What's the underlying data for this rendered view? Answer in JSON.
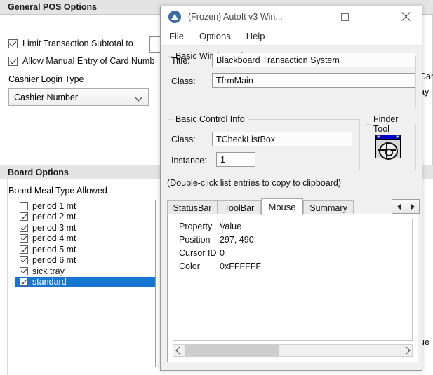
{
  "background": {
    "general_pos": {
      "header": "General POS Options",
      "checkboxes": [
        {
          "label": "Limit Transaction Subtotal to",
          "checked": true
        },
        {
          "label": "Allow Manual Entry of Card Numb",
          "checked": true
        }
      ],
      "subtotal_value": "",
      "cashier_login_label": "Cashier Login Type",
      "cashier_login_value": "Cashier Number"
    },
    "board_options": {
      "header": "Board Options",
      "list_label": "Board Meal Type Allowed",
      "items": [
        {
          "label": "period 1 mt",
          "checked": false,
          "selected": false
        },
        {
          "label": "period 2 mt",
          "checked": true,
          "selected": false
        },
        {
          "label": "period 3 mt",
          "checked": true,
          "selected": false
        },
        {
          "label": "period 4 mt",
          "checked": true,
          "selected": false
        },
        {
          "label": "period 5 mt",
          "checked": true,
          "selected": false
        },
        {
          "label": "period 6 mt",
          "checked": true,
          "selected": false
        },
        {
          "label": "sick tray",
          "checked": true,
          "selected": false
        },
        {
          "label": "standard",
          "checked": true,
          "selected": true
        }
      ]
    },
    "edge_fragments": {
      "card": "Car",
      "ay": "ay",
      "ue": "ue"
    },
    "selection_color": "#1577d2"
  },
  "autoit": {
    "title": "(Frozen) AutoIt v3 Win...",
    "window_buttons": {
      "minimize": "minimize-button",
      "maximize": "maximize-button",
      "close": "close-button"
    },
    "menu": [
      "File",
      "Options",
      "Help"
    ],
    "basic_window_info": {
      "legend": "Basic Window Info",
      "title_label": "Title:",
      "title_value": "Blackboard Transaction System",
      "class_label": "Class:",
      "class_value": "TfrmMain"
    },
    "basic_control_info": {
      "legend": "Basic Control Info",
      "class_label": "Class:",
      "class_value": "TCheckListBox",
      "instance_label": "Instance:",
      "instance_value": "1"
    },
    "finder_tool": {
      "legend": "Finder Tool"
    },
    "hint": "(Double-click list entries to copy to clipboard)",
    "tabs": [
      {
        "label": "StatusBar",
        "active": false
      },
      {
        "label": "ToolBar",
        "active": false
      },
      {
        "label": "Mouse",
        "active": true
      },
      {
        "label": "Summary",
        "active": false
      }
    ],
    "tab_spin": {
      "left": "◀",
      "right": "▶"
    },
    "property_list": {
      "columns": [
        "Property",
        "Value"
      ],
      "rows": [
        {
          "property": "Position",
          "value": "297, 490"
        },
        {
          "property": "Cursor ID",
          "value": "0"
        },
        {
          "property": "Color",
          "value": "0xFFFFFF"
        }
      ]
    },
    "scrollbar": {
      "left_arrow": "‹",
      "right_arrow": "›"
    }
  }
}
